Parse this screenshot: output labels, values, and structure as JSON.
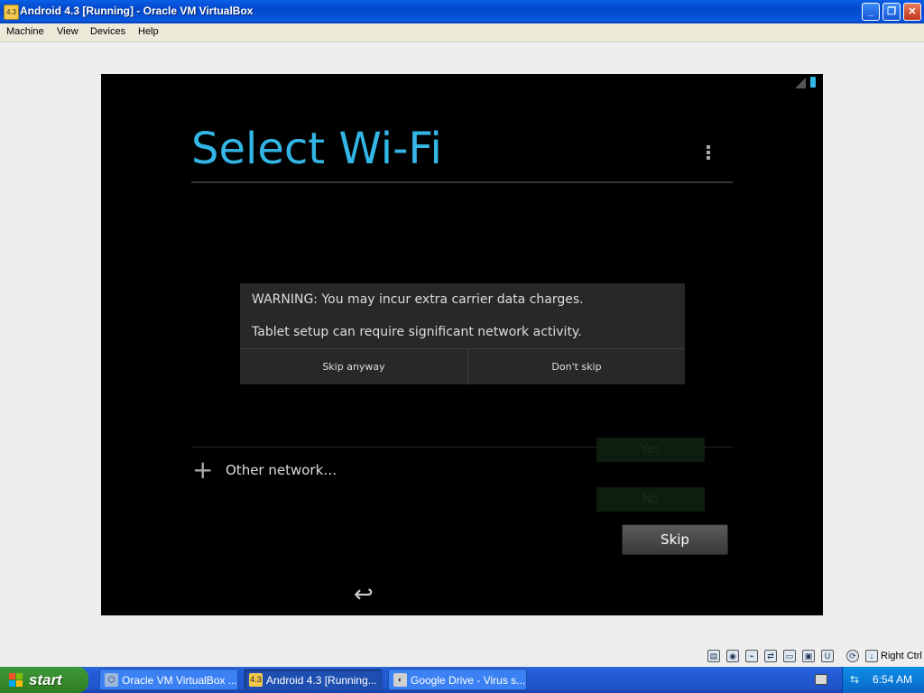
{
  "window": {
    "title": "Android 4.3 [Running] - Oracle VM VirtualBox",
    "icon": "virtualbox-vm-icon",
    "controls": [
      "minimize-icon",
      "restore-icon",
      "close-icon"
    ]
  },
  "menubar": {
    "items": [
      "Machine",
      "View",
      "Devices",
      "Help"
    ]
  },
  "android": {
    "title": "Select Wi-Fi",
    "other_network": "Other network…",
    "faded_yes": "Yes",
    "faded_no": "No",
    "skip_button": "Skip",
    "status_icons": [
      "signal-icon",
      "battery-icon"
    ],
    "accent_color": "#33b5e5"
  },
  "dialog": {
    "warning": "WARNING: You may incur extra carrier data charges.",
    "message": "Tablet setup can require significant network activity.",
    "skip_anyway": "Skip anyway",
    "dont_skip": "Don't skip"
  },
  "vbox_status": {
    "host_key": "Right Ctrl"
  },
  "taskbar": {
    "start_label": "start",
    "tasks": [
      {
        "label": "Oracle VM VirtualBox ...",
        "icon": "virtualbox-icon",
        "active": false
      },
      {
        "label": "Android 4.3 [Running...",
        "icon": "vm-icon",
        "active": true
      },
      {
        "label": "Google Drive - Virus s...",
        "icon": "browser-icon",
        "active": false
      }
    ],
    "clock": "6:54 AM"
  }
}
